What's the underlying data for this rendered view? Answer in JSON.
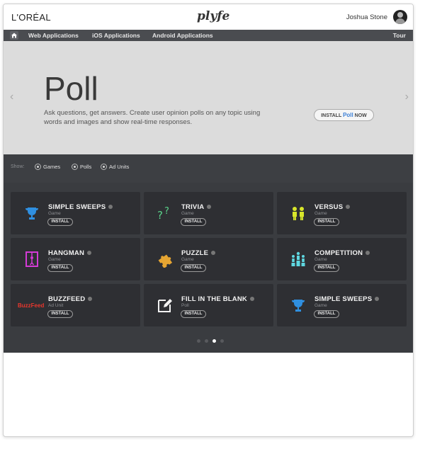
{
  "topbar": {
    "brand": "L'ORÉAL",
    "center_logo": "plyfe",
    "user_name": "Joshua Stone"
  },
  "nav": {
    "items": [
      "Web Applications",
      "iOS Applications",
      "Android Applications"
    ],
    "tour": "Tour"
  },
  "hero": {
    "title": "Poll",
    "description": "Ask questions, get answers. Create user opinion polls on any topic using words and images and show real-time responses.",
    "cta_prefix": "INSTALL ",
    "cta_accent": "Poll",
    "cta_suffix": " NOW",
    "left_arrow": "‹",
    "right_arrow": "›"
  },
  "filter": {
    "label": "Show:",
    "options": [
      "Games",
      "Polls",
      "Ad Units"
    ]
  },
  "cards": [
    {
      "title": "SIMPLE SWEEPS",
      "type": "Game",
      "install": "INSTALL",
      "icon": "trophy-icon",
      "color": "#2f8fe0"
    },
    {
      "title": "TRIVIA",
      "type": "Game",
      "install": "INSTALL",
      "icon": "question-marks-icon",
      "color": "#5ad38a"
    },
    {
      "title": "VERSUS",
      "type": "Game",
      "install": "INSTALL",
      "icon": "versus-people-icon",
      "color": "#d8e62a"
    },
    {
      "title": "HANGMAN",
      "type": "Game",
      "install": "INSTALL",
      "icon": "hangman-icon",
      "color": "#d43bd6"
    },
    {
      "title": "PUZZLE",
      "type": "Game",
      "install": "INSTALL",
      "icon": "puzzle-piece-icon",
      "color": "#e6a532"
    },
    {
      "title": "COMPETITION",
      "type": "Game",
      "install": "INSTALL",
      "icon": "podium-people-icon",
      "color": "#5fd7e0"
    },
    {
      "title": "BUZZFEED",
      "type": "Ad Unit",
      "install": "INSTALL",
      "icon": "buzzfeed-logo-icon",
      "logo_text": "BuzzFeed",
      "color": "#e8372d"
    },
    {
      "title": "FILL IN THE BLANK",
      "type": "Poll",
      "install": "INSTALL",
      "icon": "edit-pencil-icon",
      "color": "#f2f2f2"
    },
    {
      "title": "SIMPLE SWEEPS",
      "type": "Game",
      "install": "INSTALL",
      "icon": "trophy-icon",
      "color": "#2f8fe0"
    }
  ],
  "pagination": {
    "pages": 4,
    "active": 3
  }
}
